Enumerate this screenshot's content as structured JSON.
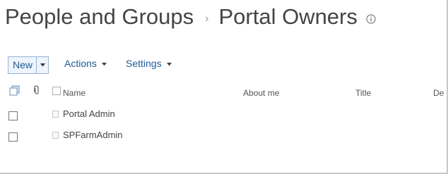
{
  "header": {
    "breadcrumb_parent": "People and Groups",
    "breadcrumb_separator": "›",
    "page_title": "Portal Owners"
  },
  "toolbar": {
    "new_label": "New",
    "actions_label": "Actions",
    "settings_label": "Settings"
  },
  "table": {
    "columns": {
      "name": "Name",
      "about_me": "About me",
      "title": "Title",
      "department_partial": "De"
    },
    "rows": [
      {
        "name": "Portal Admin"
      },
      {
        "name": "SPFarmAdmin"
      }
    ]
  },
  "icons": {
    "info": "info-icon",
    "select_all": "select-all-icon",
    "attachment": "attachment-icon",
    "row_type": "user-icon",
    "dropdown": "chevron-down-icon"
  },
  "colors": {
    "link_blue": "#1e5a96",
    "text": "#444444",
    "button_border": "#99b3d1"
  }
}
